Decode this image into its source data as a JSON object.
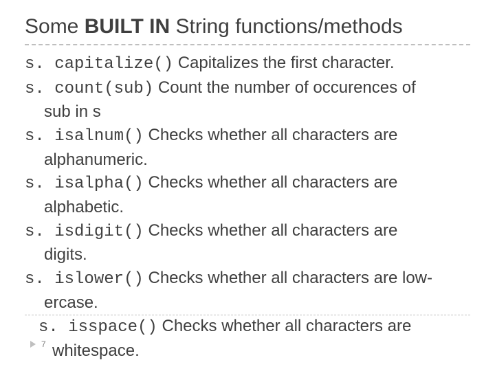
{
  "title": {
    "pre": "Some ",
    "bold": "BUILT IN",
    "post": " String functions/methods"
  },
  "items": [
    {
      "code": "s. capitalize()",
      "desc": "Capitalizes the first character."
    },
    {
      "code": "s. count(sub)",
      "desc": "Count the number of occurences of",
      "cont": "sub in s"
    },
    {
      "code": "s. isalnum()",
      "desc": "Checks whether all characters are",
      "cont": "alphanumeric."
    },
    {
      "code": "s. isalpha()",
      "desc": "Checks whether all characters are",
      "cont": "alphabetic."
    },
    {
      "code": "s. isdigit()",
      "desc": "Checks whether all characters are",
      "cont": "digits."
    },
    {
      "code": "s. islower()",
      "desc": "Checks whether all characters are low-",
      "cont": "ercase."
    },
    {
      "code": "s. isspace()",
      "desc": "Checks whether all characters are",
      "cont": "whitespace."
    }
  ],
  "page_number": "7"
}
